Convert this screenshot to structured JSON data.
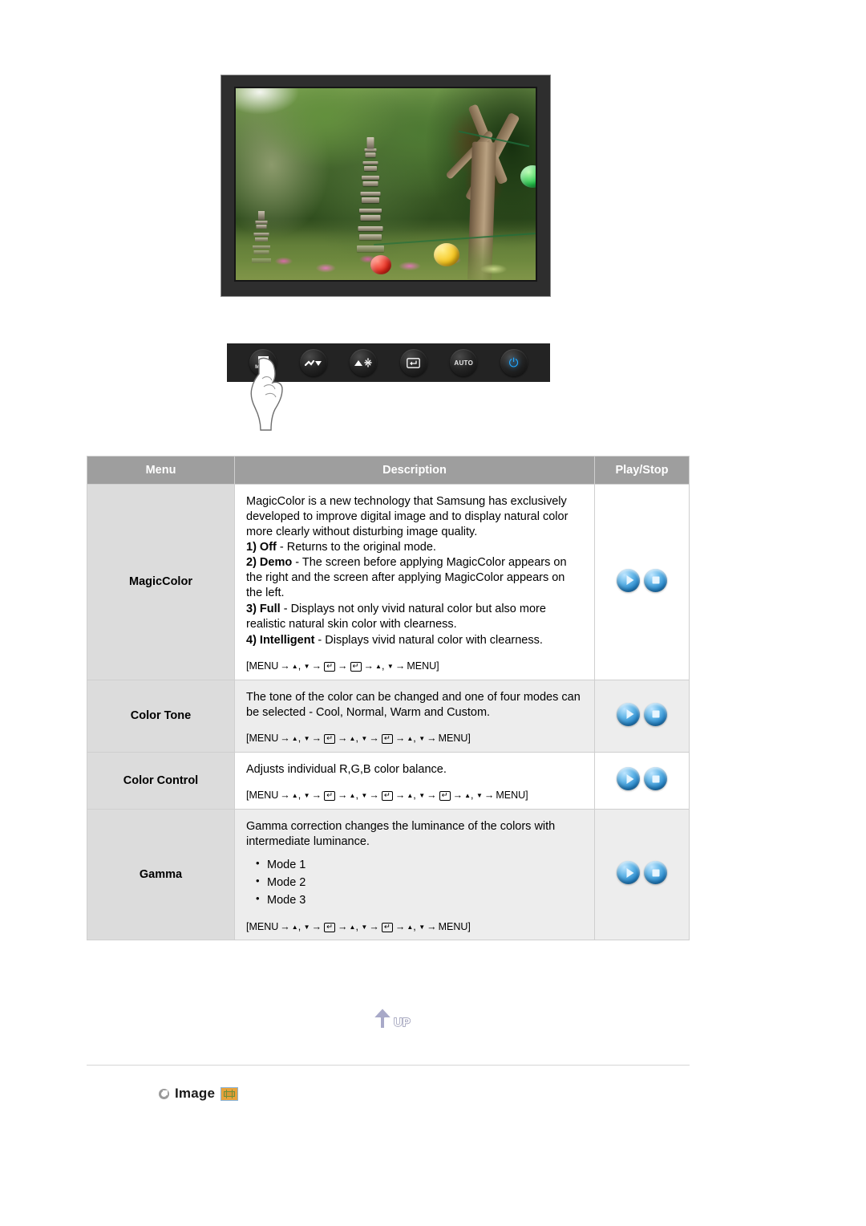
{
  "monitor": {
    "alt": "LCD monitor displaying a garden photo with stone pagoda, trees and paper lanterns"
  },
  "control_panel": {
    "buttons": [
      {
        "name": "menu-button",
        "icon": "menu-bars-icon",
        "label": "MENU"
      },
      {
        "name": "down-button",
        "icon": "volume-down-icon",
        "label": ""
      },
      {
        "name": "brightness-button",
        "icon": "brightness-up-icon",
        "label": ""
      },
      {
        "name": "enter-button",
        "icon": "enter-key-icon",
        "label": ""
      },
      {
        "name": "auto-button",
        "icon": "auto-text-icon",
        "label": "AUTO"
      },
      {
        "name": "power-button",
        "icon": "power-icon",
        "label": ""
      }
    ],
    "pointer": "hand-pointer-icon"
  },
  "table": {
    "headers": {
      "menu": "Menu",
      "description": "Description",
      "play_stop": "Play/Stop"
    },
    "rows": [
      {
        "menu": "MagicColor",
        "intro": "MagicColor is a new technology that Samsung has exclusively developed to improve digital image and to display natural color more clearly without disturbing image quality.",
        "options": [
          {
            "num": "1) Off",
            "text": " - Returns to the original mode."
          },
          {
            "num": "2) Demo",
            "text": " - The screen before applying MagicColor appears on the right and the screen after applying MagicColor appears on the left."
          },
          {
            "num": "3) Full",
            "text": " - Displays not only vivid natural color but also more realistic natural skin color with clearness."
          },
          {
            "num": "4) Intelligent",
            "text": " - Displays vivid natural color with clearness."
          }
        ],
        "bullets": [],
        "path_steps": [
          "MENU",
          "updown",
          "enter",
          "enter",
          "updown",
          "MENU"
        ],
        "play_label": "Play",
        "stop_label": "Stop"
      },
      {
        "menu": "Color Tone",
        "intro": "The tone of the color can be changed and one of four modes can be selected - Cool, Normal, Warm and Custom.",
        "options": [],
        "bullets": [],
        "path_steps": [
          "MENU",
          "updown",
          "enter",
          "updown",
          "enter",
          "updown",
          "MENU"
        ],
        "play_label": "Play",
        "stop_label": "Stop"
      },
      {
        "menu": "Color Control",
        "intro": "Adjusts individual R,G,B color balance.",
        "options": [],
        "bullets": [],
        "path_steps": [
          "MENU",
          "updown",
          "enter",
          "updown",
          "enter",
          "updown",
          "enter",
          "updown",
          "MENU"
        ],
        "play_label": "Play",
        "stop_label": "Stop"
      },
      {
        "menu": "Gamma",
        "intro": "Gamma correction changes the luminance of the colors with intermediate luminance.",
        "options": [],
        "bullets": [
          "Mode 1",
          "Mode 2",
          "Mode 3"
        ],
        "path_steps": [
          "MENU",
          "updown",
          "enter",
          "updown",
          "enter",
          "updown",
          "MENU"
        ],
        "play_label": "Play",
        "stop_label": "Stop"
      }
    ]
  },
  "up_button": {
    "label": "UP"
  },
  "section": {
    "label": "Image",
    "badge_icon": "image-adjust-icon"
  },
  "colors": {
    "header_bg": "#9e9e9e",
    "menu_cell_bg": "#dcdcdc",
    "shaded_row_bg": "#ededed",
    "button_blue": "#1f7fc4",
    "badge_orange": "#e8a33d",
    "power_blue": "#21a7ff"
  }
}
